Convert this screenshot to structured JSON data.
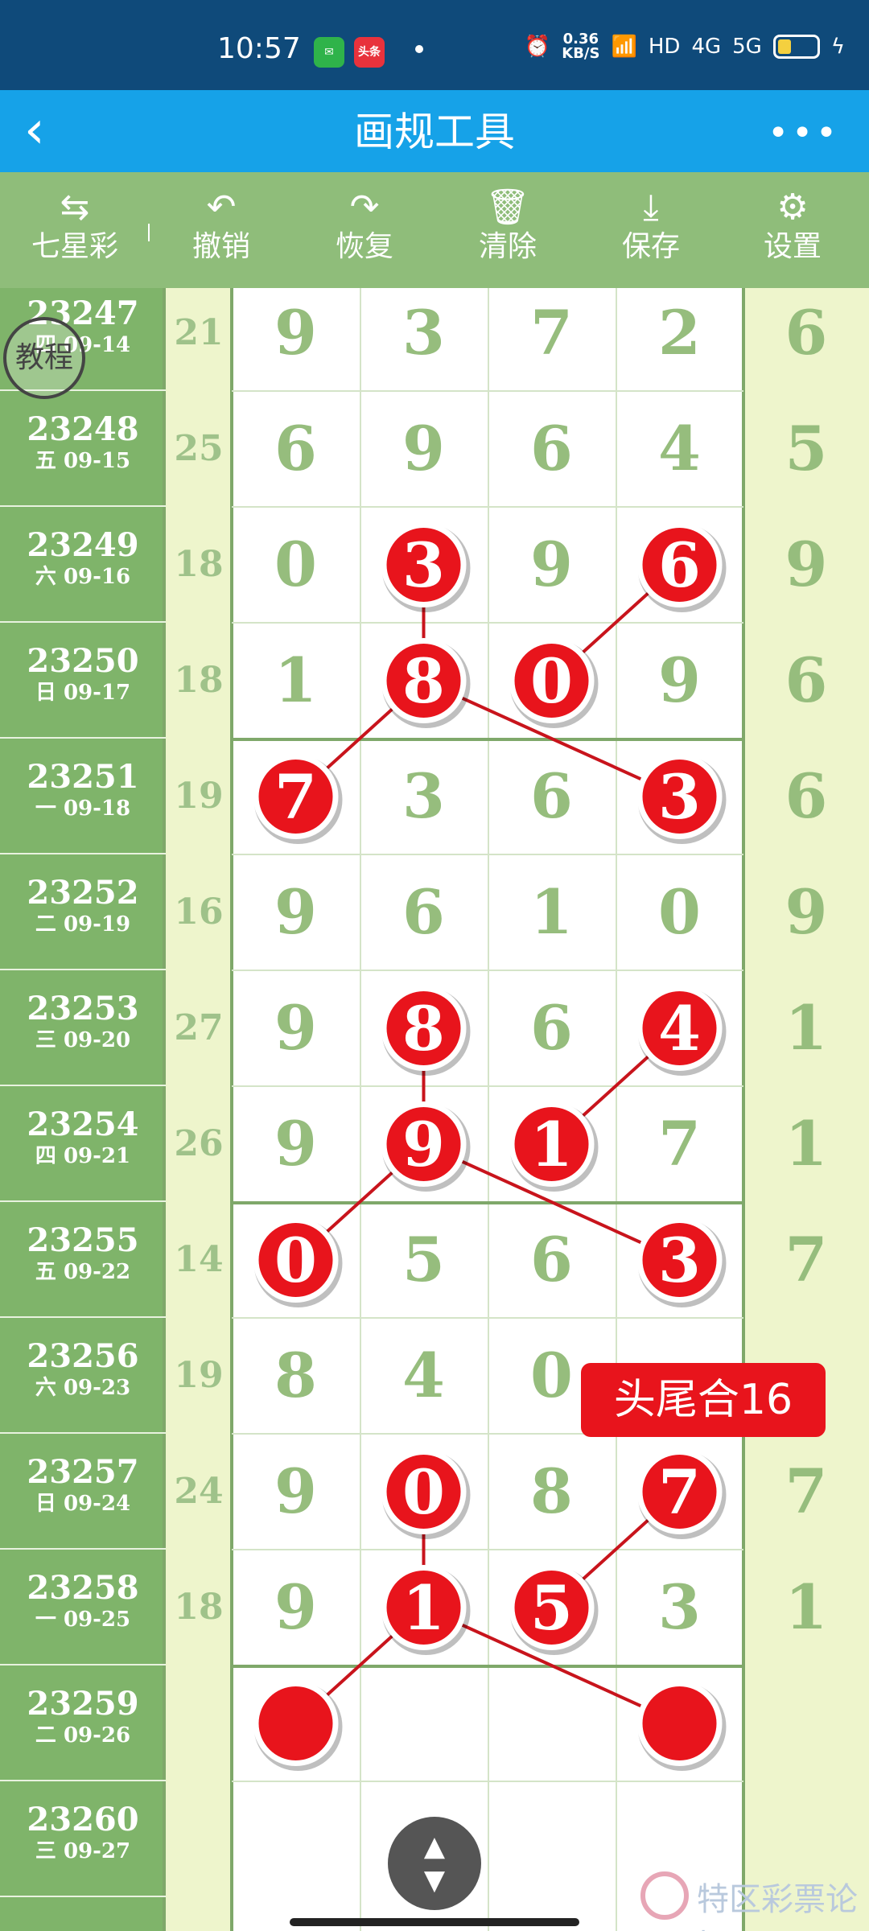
{
  "status": {
    "time": "10:57",
    "speed_value": "0.36",
    "speed_unit": "KB/S",
    "hd": "HD",
    "net1": "4G",
    "net2": "5G",
    "app2": "头条"
  },
  "appbar": {
    "back": "‹",
    "title": "画规工具",
    "more": "•••"
  },
  "toolbar": {
    "lottery": "七星彩",
    "undo": "撤销",
    "redo": "恢复",
    "clear": "清除",
    "save": "保存",
    "settings": "设置"
  },
  "tutorial_badge": "教程",
  "annotation_tag": "头尾合16",
  "watermark": "特区彩票论坛",
  "rows": [
    {
      "issue": "23247",
      "date": "四 09-14",
      "sum": "21",
      "digits": [
        "9",
        "3",
        "7",
        "2"
      ],
      "last": "6"
    },
    {
      "issue": "23248",
      "date": "五 09-15",
      "sum": "25",
      "digits": [
        "6",
        "9",
        "6",
        "4"
      ],
      "last": "5"
    },
    {
      "issue": "23249",
      "date": "六 09-16",
      "sum": "18",
      "digits": [
        "0",
        "3",
        "9",
        "6"
      ],
      "last": "9"
    },
    {
      "issue": "23250",
      "date": "日 09-17",
      "sum": "18",
      "digits": [
        "1",
        "8",
        "0",
        "9"
      ],
      "last": "6"
    },
    {
      "issue": "23251",
      "date": "一 09-18",
      "sum": "19",
      "digits": [
        "7",
        "3",
        "6",
        "3"
      ],
      "last": "6"
    },
    {
      "issue": "23252",
      "date": "二 09-19",
      "sum": "16",
      "digits": [
        "9",
        "6",
        "1",
        "0"
      ],
      "last": "9"
    },
    {
      "issue": "23253",
      "date": "三 09-20",
      "sum": "27",
      "digits": [
        "9",
        "8",
        "6",
        "4"
      ],
      "last": "1"
    },
    {
      "issue": "23254",
      "date": "四 09-21",
      "sum": "26",
      "digits": [
        "9",
        "9",
        "1",
        "7"
      ],
      "last": "1"
    },
    {
      "issue": "23255",
      "date": "五 09-22",
      "sum": "14",
      "digits": [
        "0",
        "5",
        "6",
        "3"
      ],
      "last": "7"
    },
    {
      "issue": "23256",
      "date": "六 09-23",
      "sum": "19",
      "digits": [
        "8",
        "4",
        "0",
        ""
      ],
      "last": ""
    },
    {
      "issue": "23257",
      "date": "日 09-24",
      "sum": "24",
      "digits": [
        "9",
        "0",
        "8",
        "7"
      ],
      "last": "7"
    },
    {
      "issue": "23258",
      "date": "一 09-25",
      "sum": "18",
      "digits": [
        "9",
        "1",
        "5",
        "3"
      ],
      "last": "1"
    },
    {
      "issue": "23259",
      "date": "二 09-26",
      "sum": "",
      "digits": [
        "",
        "",
        "",
        ""
      ],
      "last": ""
    },
    {
      "issue": "23260",
      "date": "三 09-27",
      "sum": "",
      "digits": [
        "",
        "",
        "",
        ""
      ],
      "last": ""
    }
  ],
  "marks": [
    {
      "row": 2,
      "col": 1,
      "label": "3"
    },
    {
      "row": 2,
      "col": 3,
      "label": "6"
    },
    {
      "row": 3,
      "col": 1,
      "label": "8"
    },
    {
      "row": 3,
      "col": 2,
      "label": "0"
    },
    {
      "row": 4,
      "col": 0,
      "label": "7"
    },
    {
      "row": 4,
      "col": 3,
      "label": "3"
    },
    {
      "row": 6,
      "col": 1,
      "label": "8"
    },
    {
      "row": 6,
      "col": 3,
      "label": "4"
    },
    {
      "row": 7,
      "col": 1,
      "label": "9"
    },
    {
      "row": 7,
      "col": 2,
      "label": "1"
    },
    {
      "row": 8,
      "col": 0,
      "label": "0"
    },
    {
      "row": 8,
      "col": 3,
      "label": "3"
    },
    {
      "row": 10,
      "col": 1,
      "label": "0"
    },
    {
      "row": 10,
      "col": 3,
      "label": "7"
    },
    {
      "row": 11,
      "col": 1,
      "label": "1"
    },
    {
      "row": 11,
      "col": 2,
      "label": "5"
    },
    {
      "row": 12,
      "col": 0,
      "label": ""
    },
    {
      "row": 12,
      "col": 3,
      "label": ""
    }
  ],
  "lines": [
    [
      [
        2,
        1
      ],
      [
        3,
        1
      ]
    ],
    [
      [
        2,
        3
      ],
      [
        3,
        2
      ]
    ],
    [
      [
        3,
        1
      ],
      [
        4,
        0
      ]
    ],
    [
      [
        3,
        1
      ],
      [
        4,
        3
      ]
    ],
    [
      [
        6,
        1
      ],
      [
        7,
        1
      ]
    ],
    [
      [
        6,
        3
      ],
      [
        7,
        2
      ]
    ],
    [
      [
        7,
        1
      ],
      [
        8,
        0
      ]
    ],
    [
      [
        7,
        1
      ],
      [
        8,
        3
      ]
    ],
    [
      [
        10,
        1
      ],
      [
        11,
        1
      ]
    ],
    [
      [
        10,
        3
      ],
      [
        11,
        2
      ]
    ],
    [
      [
        11,
        1
      ],
      [
        12,
        0
      ]
    ],
    [
      [
        11,
        1
      ],
      [
        12,
        3
      ]
    ]
  ]
}
